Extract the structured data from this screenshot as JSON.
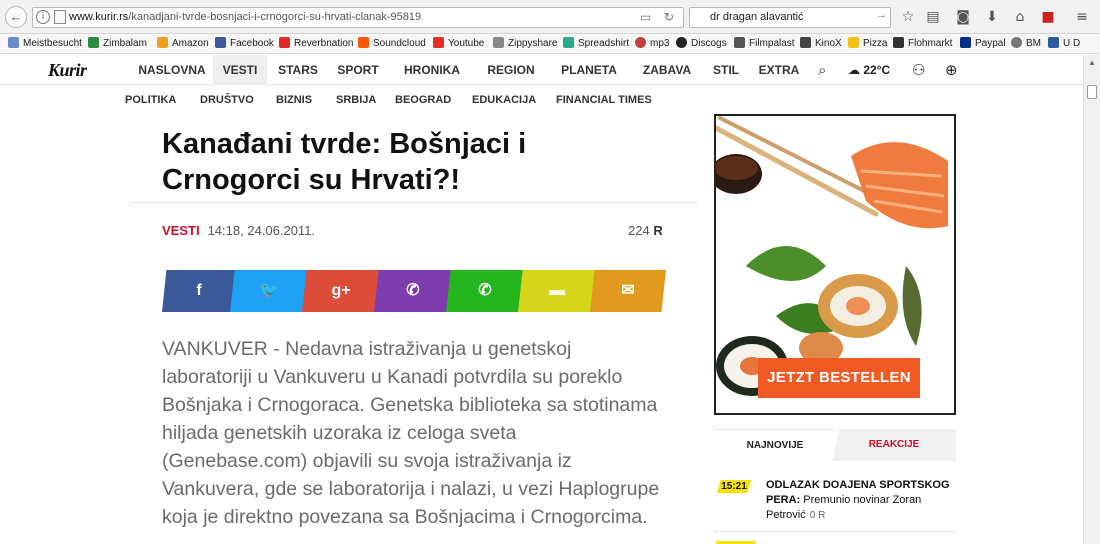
{
  "browser": {
    "url_host": "www.kurir.rs",
    "url_path": "/kanadjani-tvrde-bosnjaci-i-crnogorci-su-hrvati-clanak-95819",
    "search_value": "dr dragan alavantić",
    "bookmarks": [
      "Meistbesucht",
      "Zimbalam",
      "Amazon",
      "Facebook",
      "Reverbnation",
      "Soundcloud",
      "Youtube",
      "Zippyshare",
      "Spreadshirt",
      "mp3",
      "Discogs",
      "Filmpalast",
      "KinoX",
      "Pizza",
      "Flohmarkt",
      "Paypal",
      "BM",
      "U D"
    ]
  },
  "site": {
    "logo": "Kurir",
    "nav": [
      "NASLOVNA",
      "VESTI",
      "STARS",
      "SPORT",
      "HRONIKA",
      "REGION",
      "PLANETA",
      "ZABAVA",
      "STIL",
      "EXTRA"
    ],
    "active_nav": "VESTI",
    "temperature": "22°C",
    "subnav": [
      "POLITIKA",
      "DRUŠTVO",
      "BIZNIS",
      "SRBIJA",
      "BEOGRAD",
      "EDUKACIJA",
      "FINANCIAL TIMES"
    ]
  },
  "article": {
    "title_line1": "Kanađani tvrde: Bošnjaci i",
    "title_line2": "Crnogorci su Hrvati?!",
    "category": "VESTI",
    "datetime": "14:18, 24.06.2011.",
    "reads": "224",
    "reads_icon": "R",
    "share": [
      {
        "label": "f",
        "color": "#3b5998"
      },
      {
        "label": "🐦",
        "color": "#1da1f2"
      },
      {
        "label": "g+",
        "color": "#dd4b39"
      },
      {
        "label": "✆",
        "color": "#7d3daf"
      },
      {
        "label": "✆",
        "color": "#25b51f"
      },
      {
        "label": "▬",
        "color": "#d5d51a"
      },
      {
        "label": "✉",
        "color": "#e29a1e"
      }
    ],
    "lead": "VANKUVER - Nedavna istraživanja u genetskoj laboratoriji u Vankuveru u Kanadi potvrdila su poreklo Bošnjaka i Crnogoraca. Genetska biblioteka sa stotinama hiljada genetskih uzoraka iz celoga sveta (Genebase.com) objavili su svoja istraživanja iz Vankuvera, gde se laboratorija i nalazi, u vezi Haplogrupe koja je direktno povezana sa Bošnjacima i Crnogorcima."
  },
  "ad": {
    "button": "JETZT BESTELLEN"
  },
  "sidebar": {
    "tab_latest": "NAJNOVIJE",
    "tab_reactions": "REAKCIJE",
    "news": [
      {
        "time": "15:21",
        "head": "ODLAZAK DOAJENA SPORTSKOG PERA:",
        "rest": "Premunio novinar Zoran Petrović",
        "count": "0"
      }
    ]
  }
}
